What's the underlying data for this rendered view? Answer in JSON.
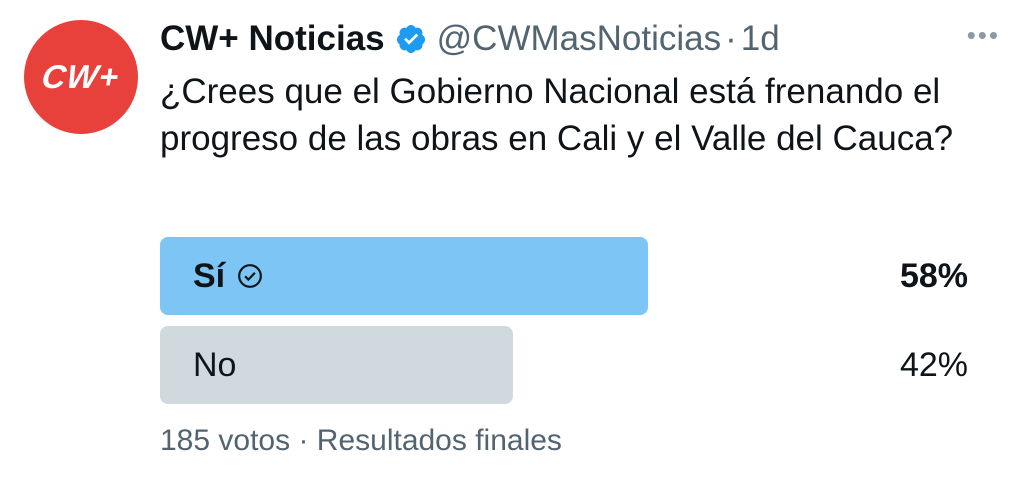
{
  "account": {
    "avatar_text": "CW+",
    "display_name": "CW+ Noticias",
    "handle": "@CWMasNoticias",
    "separator": "·",
    "time": "1d",
    "more_label": "•••"
  },
  "tweet": {
    "text": "¿Crees que el Gobierno Nacional está frenando el progreso de las obras en Cali y el Valle del Cauca?"
  },
  "poll": {
    "options": [
      {
        "label": "Sí",
        "percent_label": "58%",
        "percent": 58,
        "winner": true,
        "bar_color": "#7cc5f5"
      },
      {
        "label": "No",
        "percent_label": "42%",
        "percent": 42,
        "winner": false,
        "bar_color": "#cfd9de"
      }
    ],
    "votes": "185 votos",
    "separator": "·",
    "status": "Resultados finales"
  },
  "colors": {
    "avatar_bg": "#e8413b",
    "verified": "#1d9bf0",
    "secondary_text": "#536471"
  }
}
